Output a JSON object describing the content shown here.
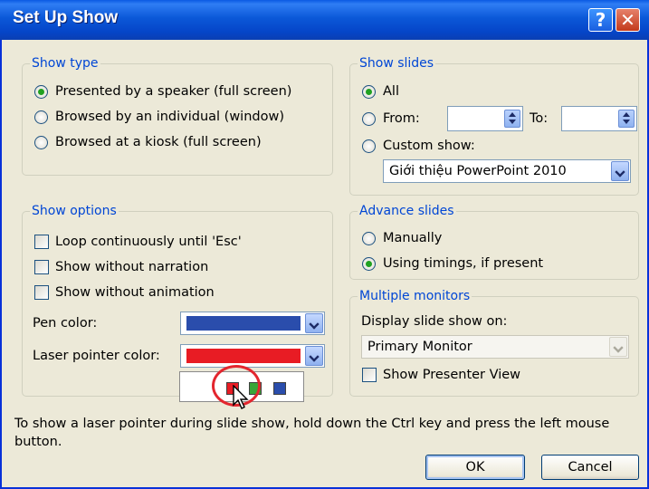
{
  "window": {
    "title": "Set Up Show",
    "help_glyph": "?",
    "close_glyph": "✕"
  },
  "show_type": {
    "title": "Show type",
    "options": [
      {
        "label": "Presented by a speaker (full screen)",
        "selected": true
      },
      {
        "label": "Browsed by an individual (window)",
        "selected": false
      },
      {
        "label": "Browsed at a kiosk (full screen)",
        "selected": false
      }
    ]
  },
  "show_slides": {
    "title": "Show slides",
    "all_label": "All",
    "from_label": "From:",
    "to_label": "To:",
    "from_value": "",
    "to_value": "",
    "custom_label": "Custom show:",
    "custom_value": "Giới thiệu PowerPoint 2010"
  },
  "show_options": {
    "title": "Show options",
    "checks": [
      {
        "label": "Loop continuously until 'Esc'",
        "checked": false
      },
      {
        "label": "Show without narration",
        "checked": false
      },
      {
        "label": "Show without animation",
        "checked": false
      }
    ],
    "pen_label": "Pen color:",
    "laser_label": "Laser pointer color:",
    "pen_color": "#2a4dac",
    "laser_color": "#e81c24",
    "laser_choices": [
      "#e81c24",
      "#3aa537",
      "#2a4dac"
    ]
  },
  "advance_slides": {
    "title": "Advance slides",
    "manual_label": "Manually",
    "timings_label": "Using timings, if present",
    "selected": "timings"
  },
  "monitors": {
    "title": "Multiple monitors",
    "display_label": "Display slide show on:",
    "display_value": "Primary Monitor",
    "presenter_label": "Show Presenter View"
  },
  "footer_text": "To show a laser pointer during slide show, hold down the Ctrl key and press the left mouse button.",
  "buttons": {
    "ok": "OK",
    "cancel": "Cancel"
  },
  "colors": {
    "title_bar": "#0a5ae3",
    "group_title": "#0046d5",
    "dialog_bg": "#ece9d8",
    "highlight_ring": "#e3262e"
  }
}
